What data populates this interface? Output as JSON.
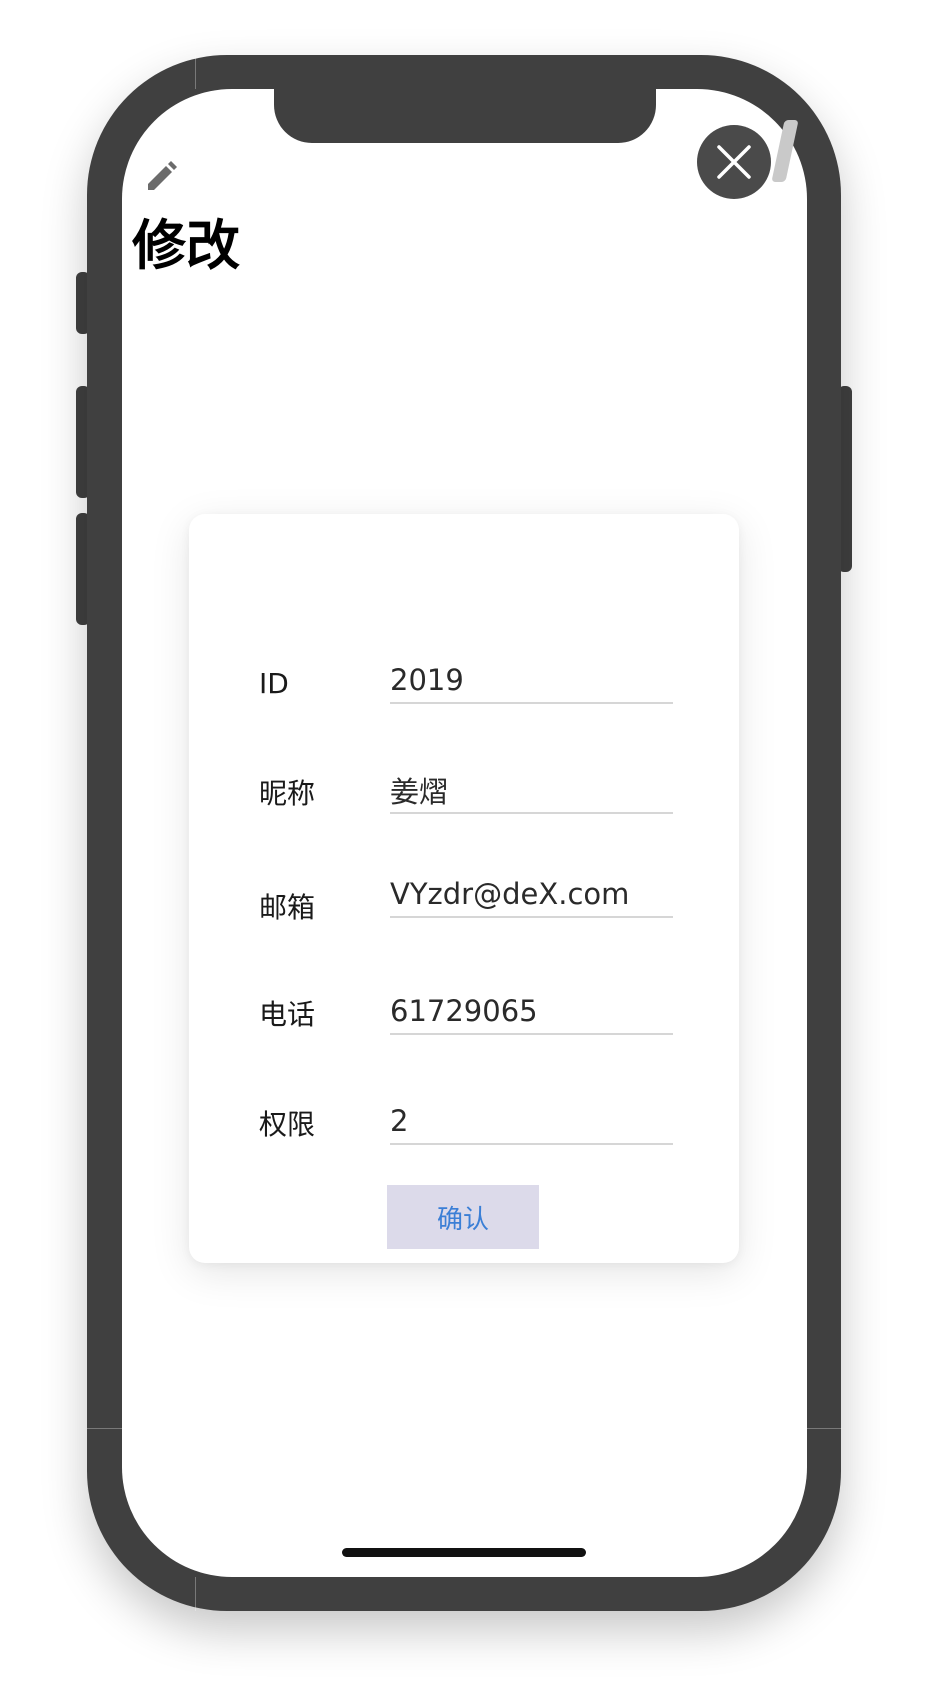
{
  "header": {
    "title": "修改",
    "edit_icon": "pencil-icon",
    "close_icon": "close-icon"
  },
  "form": {
    "fields": [
      {
        "label": "ID",
        "value": "2019"
      },
      {
        "label": "昵称",
        "value": "姜熠"
      },
      {
        "label": "邮箱",
        "value": "VYzdr@deX.com"
      },
      {
        "label": "电话",
        "value": "61729065"
      },
      {
        "label": "权限",
        "value": "2"
      }
    ],
    "confirm_label": "确认"
  },
  "colors": {
    "phone_frame": "#404040",
    "close_button_bg": "#4a4a4a",
    "confirm_button_bg": "#dcdaea",
    "confirm_button_text": "#3b7fd6",
    "input_underline": "#d6d6d6"
  }
}
